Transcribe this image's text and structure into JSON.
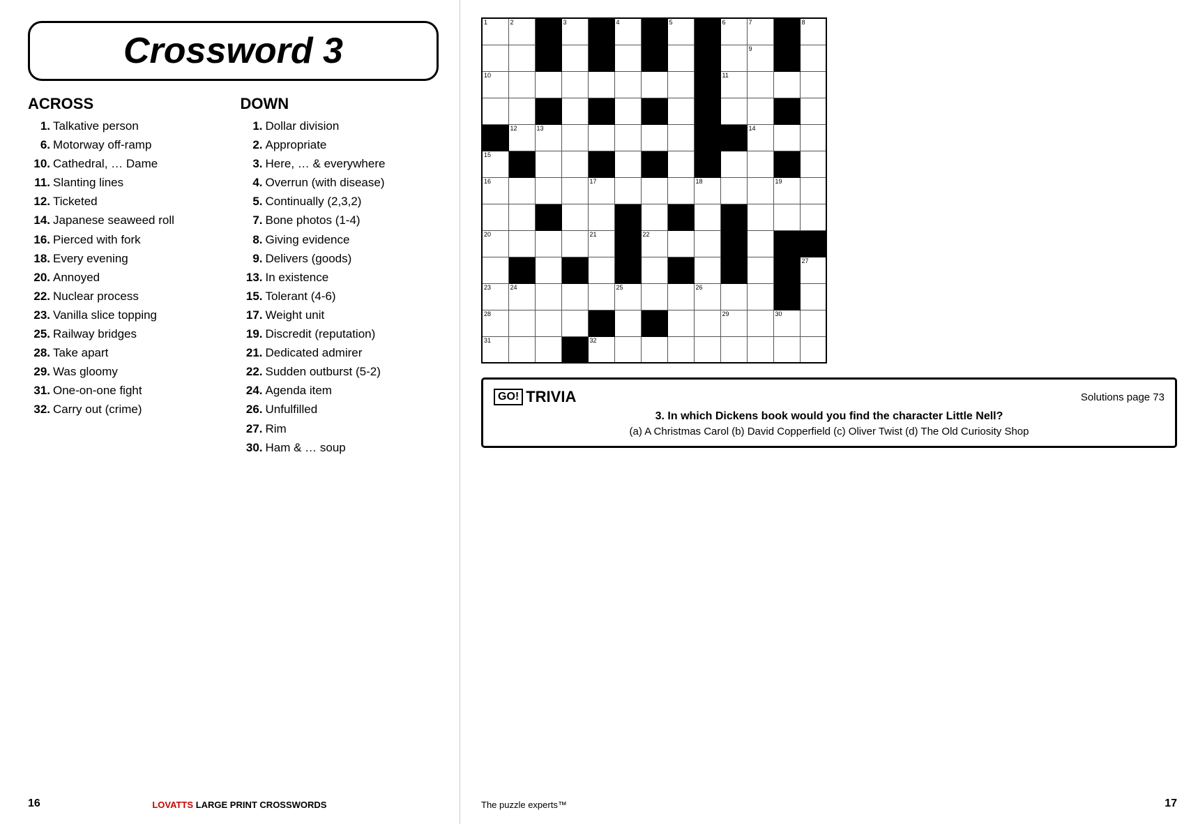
{
  "title": "Crossword   3",
  "across_label": "ACROSS",
  "down_label": "DOWN",
  "across_clues": [
    {
      "num": "1.",
      "text": "Talkative person"
    },
    {
      "num": "6.",
      "text": "Motorway off-ramp"
    },
    {
      "num": "10.",
      "text": "Cathedral, … Dame"
    },
    {
      "num": "11.",
      "text": "Slanting lines"
    },
    {
      "num": "12.",
      "text": "Ticketed"
    },
    {
      "num": "14.",
      "text": "Japanese seaweed roll"
    },
    {
      "num": "16.",
      "text": "Pierced with fork"
    },
    {
      "num": "18.",
      "text": "Every evening"
    },
    {
      "num": "20.",
      "text": "Annoyed"
    },
    {
      "num": "22.",
      "text": "Nuclear process"
    },
    {
      "num": "23.",
      "text": "Vanilla slice topping"
    },
    {
      "num": "25.",
      "text": "Railway bridges"
    },
    {
      "num": "28.",
      "text": "Take apart"
    },
    {
      "num": "29.",
      "text": "Was gloomy"
    },
    {
      "num": "31.",
      "text": "One-on-one fight"
    },
    {
      "num": "32.",
      "text": "Carry out (crime)"
    }
  ],
  "down_clues": [
    {
      "num": "1.",
      "text": "Dollar division"
    },
    {
      "num": "2.",
      "text": "Appropriate"
    },
    {
      "num": "3.",
      "text": "Here, … & everywhere"
    },
    {
      "num": "4.",
      "text": "Overrun (with disease)"
    },
    {
      "num": "5.",
      "text": "Continually (2,3,2)"
    },
    {
      "num": "7.",
      "text": "Bone photos (1-4)"
    },
    {
      "num": "8.",
      "text": "Giving evidence"
    },
    {
      "num": "9.",
      "text": "Delivers (goods)"
    },
    {
      "num": "13.",
      "text": "In existence"
    },
    {
      "num": "15.",
      "text": "Tolerant (4-6)"
    },
    {
      "num": "17.",
      "text": "Weight unit"
    },
    {
      "num": "19.",
      "text": "Discredit (reputation)"
    },
    {
      "num": "21.",
      "text": "Dedicated admirer"
    },
    {
      "num": "22.",
      "text": "Sudden outburst (5-2)"
    },
    {
      "num": "24.",
      "text": "Agenda item"
    },
    {
      "num": "26.",
      "text": "Unfulfilled"
    },
    {
      "num": "27.",
      "text": "Rim"
    },
    {
      "num": "30.",
      "text": "Ham & … soup"
    }
  ],
  "trivia": {
    "logo_go": "GO!",
    "logo_trivia": "TRIVIA",
    "solutions": "Solutions page 73",
    "question_num": "3.",
    "question": "In which Dickens book would you find the character Little Nell?",
    "answers": "(a) A Christmas Carol (b) David Copperfield (c) Oliver Twist (d) The Old Curiosity Shop"
  },
  "footer": {
    "page_left": "16",
    "brand": "LOVATTS",
    "footer_text": "LARGE PRINT CROSSWORDS",
    "tagline": "The puzzle experts™",
    "page_right": "17"
  }
}
